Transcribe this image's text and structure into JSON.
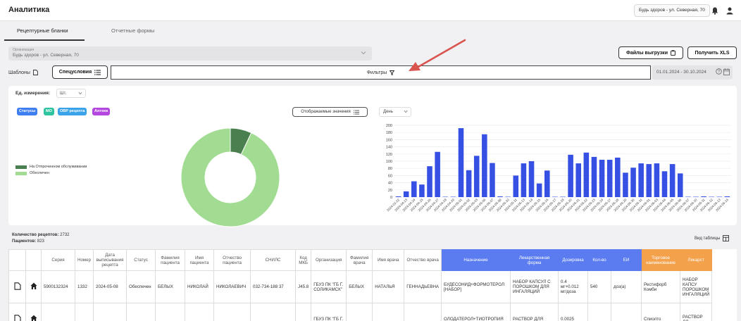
{
  "app": {
    "title": "Аналитика",
    "org_chip": "Будь здоров - ул. Северная, 70"
  },
  "tabs": [
    {
      "label": "Рецептурные бланки"
    },
    {
      "label": "Отчетные формы"
    }
  ],
  "org_select": {
    "label": "Организация",
    "value": "Будь здоров - ул. Северная, 70"
  },
  "buttons": {
    "export_files": "Файлы выгрузки",
    "get_xls": "Получить XLS",
    "templates": "Шаблоны",
    "special": "Спецусловия"
  },
  "filters": {
    "label": "Фильтры",
    "date_range": "01.01.2024 - 30.10.2024"
  },
  "controls": {
    "unit_label": "Ед. измерения:",
    "unit_value": "Шт.",
    "display_values": "Отображаемые значения",
    "period_value": "День"
  },
  "chips": [
    {
      "label": "Статусы",
      "color": "#3f7ef0"
    },
    {
      "label": "МО",
      "color": "#2ec4a0"
    },
    {
      "label": "ОВР рецепта",
      "color": "#3aa2e8"
    },
    {
      "label": "Аптеки",
      "color": "#b347e0"
    }
  ],
  "colors": {
    "accent_blue": "#3650e3",
    "donut_dark": "#4a7f4f",
    "donut_light": "#a2dc93",
    "arrow": "#d9534f"
  },
  "summary": {
    "recipes_label": "Количество рецептов:",
    "recipes_value": "2732",
    "patients_label": "Пациентов:",
    "patients_value": "823",
    "view_table": "Вид таблицы"
  },
  "chart_data": [
    {
      "type": "pie",
      "labels": [
        "На Отпроченном обслуживании",
        "Обеспечен"
      ],
      "values": [
        7,
        93
      ],
      "colors": [
        "#4a7f4f",
        "#a2dc93"
      ]
    },
    {
      "type": "bar",
      "categories": [
        "2024-01-22",
        "2024-04-23",
        "2024-04-24",
        "2024-04-25",
        "2024-04-26",
        "2024-04-27",
        "2024-04-28",
        "2024-04-29",
        "2024-05-01",
        "2024-05-02",
        "2024-05-03",
        "2024-05-06",
        "2024-05-07",
        "2024-05-08",
        "2024-05-10",
        "2024-05-11",
        "2024-05-13",
        "2024-05-14",
        "2024-05-15",
        "2024-05-16",
        "2024-05-17",
        "2024-05-18",
        "2024-05-20",
        "2024-05-21",
        "2024-05-22",
        "2024-05-23",
        "2024-05-24",
        "2024-05-27",
        "2024-05-28",
        "2024-05-29",
        "2024-05-30",
        "2024-05-31",
        "2024-06-01",
        "2024-06-03",
        "2024-06-04",
        "2024-06-05",
        "2024-06-06",
        "2024-06-07",
        "2024-06-10",
        "2024-06-11",
        "2024-06-12",
        "2024-06-13",
        "2024-06-14"
      ],
      "values": [
        2,
        16,
        44,
        35,
        86,
        126,
        1,
        1,
        192,
        75,
        115,
        175,
        95,
        2,
        1,
        60,
        94,
        100,
        38,
        74,
        1,
        1,
        118,
        94,
        124,
        112,
        104,
        104,
        110,
        68,
        82,
        94,
        92,
        94,
        72,
        92,
        66,
        1,
        1,
        2,
        1,
        1,
        2
      ],
      "ylim": [
        0,
        200
      ],
      "yticks": [
        0,
        20,
        40,
        60,
        80,
        100,
        120,
        140,
        160,
        180,
        200
      ],
      "color": "#3650e3"
    }
  ],
  "table": {
    "headers": [
      {
        "text": "",
        "style": ""
      },
      {
        "text": "",
        "style": ""
      },
      {
        "text": "Серия",
        "style": ""
      },
      {
        "text": "Номер",
        "style": ""
      },
      {
        "text": "Дата выписывания рецепта",
        "style": ""
      },
      {
        "text": "Статус",
        "style": ""
      },
      {
        "text": "Фамилия пациента",
        "style": ""
      },
      {
        "text": "Имя пациента",
        "style": ""
      },
      {
        "text": "Отчество пациента",
        "style": ""
      },
      {
        "text": "СНИЛС",
        "style": ""
      },
      {
        "text": "Код МКБ",
        "style": ""
      },
      {
        "text": "Организация",
        "style": ""
      },
      {
        "text": "Фамилия врача",
        "style": ""
      },
      {
        "text": "Имя врача",
        "style": ""
      },
      {
        "text": "Отчество врача",
        "style": ""
      },
      {
        "text": "Назначение",
        "style": "blue"
      },
      {
        "text": "Лекарственная форма",
        "style": "blue"
      },
      {
        "text": "Дозировка",
        "style": "blue"
      },
      {
        "text": "Кол-во",
        "style": "blue"
      },
      {
        "text": "ЕИ",
        "style": "blue"
      },
      {
        "text": "Торговое наименование",
        "style": "orange"
      },
      {
        "text": "Лекарст",
        "style": "orange"
      }
    ],
    "rows": [
      [
        "",
        "",
        "5900132324",
        "1332",
        "2024-05-08",
        "Обеспечен",
        "БЕЛЫХ",
        "НИКОЛАЙ",
        "НИКОЛАЕВИЧ",
        "032-734-188 37",
        "J45.8",
        "ГБУЗ ПК \"ГБ Г. СОЛИКАМСК\"",
        "БЕЛЫХ",
        "НАТАЛЬЯ",
        "ГЕННАДЬЕВНА",
        "БУДЕСОНИД+ФОРМОТЕРОЛ [НАБОР]",
        "НАБОР КАПСУЛ С ПОРОШКОМ ДЛЯ ИНГАЛЯЦИЙ",
        "0.4 мг+0.012 мг/доза",
        "540",
        "доз(а)",
        "Рестифорб Комби",
        "НАБОР КАПСУ ПОРОШКОМ ИНГАЛЯЦИЙ"
      ],
      [
        "",
        "",
        "",
        "",
        "",
        "",
        "",
        "",
        "",
        "",
        "",
        "ГБУЗ ПК \"ГБ Г.",
        "",
        "",
        "",
        "ОЛОДАТЕРОЛ+ТИОТРОПИЯ",
        "РАСТВОР ДЛЯ",
        "0.0025",
        "",
        "",
        "Спиолто",
        "РАСТВОР ДЛ"
      ]
    ]
  }
}
